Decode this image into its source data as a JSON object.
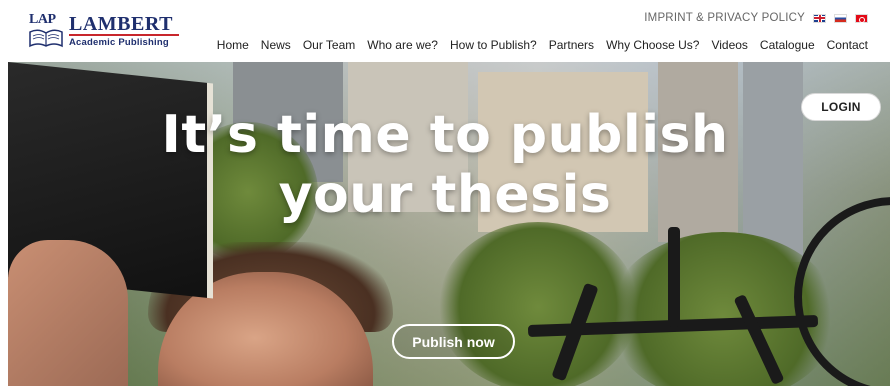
{
  "logo": {
    "badge_text": "LAP",
    "title": "LAMBERT",
    "subtitle": "Academic Publishing"
  },
  "topbar": {
    "imprint_label": "IMPRINT & PRIVACY POLICY",
    "flags": [
      "uk-flag-icon",
      "russia-flag-icon",
      "turkey-flag-icon"
    ]
  },
  "nav": {
    "items": [
      "Home",
      "News",
      "Our Team",
      "Who are we?",
      "How to Publish?",
      "Partners",
      "Why Choose Us?",
      "Videos",
      "Catalogue",
      "Contact"
    ]
  },
  "hero": {
    "title_line1": "It’s time to publish",
    "title_line2": "your thesis",
    "login_label": "LOGIN",
    "cta_label": "Publish now"
  },
  "colors": {
    "brand_navy": "#1f2f6e",
    "brand_red": "#c8262c"
  }
}
